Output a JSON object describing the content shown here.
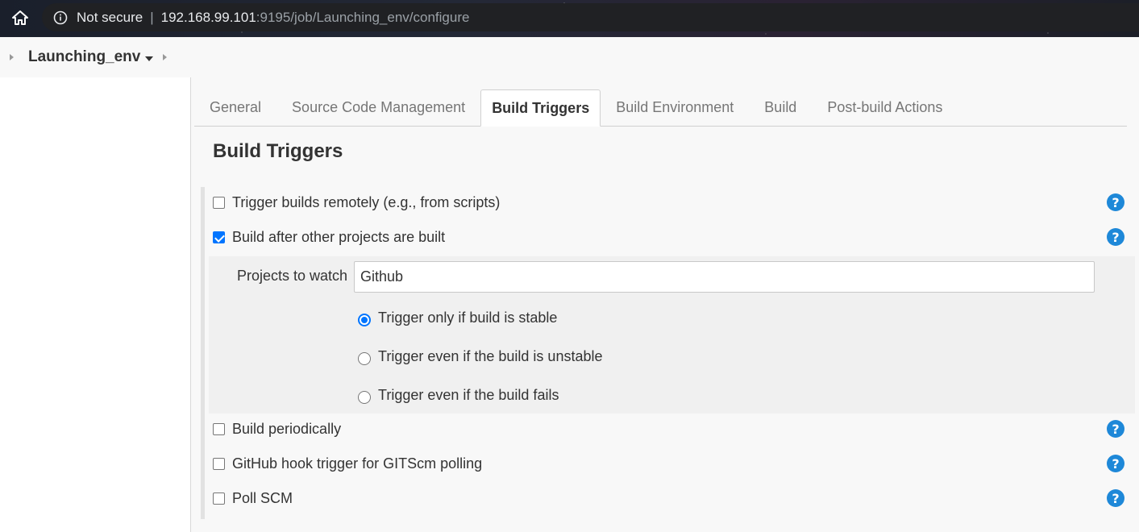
{
  "browser": {
    "home_icon": "home-icon",
    "security_icon": "info-icon",
    "security_label": "Not secure",
    "url_host": "192.168.99.101",
    "url_rest": ":9195/job/Launching_env/configure"
  },
  "breadcrumb": {
    "job_name": "Launching_env"
  },
  "tabs": [
    {
      "label": "General",
      "active": false
    },
    {
      "label": "Source Code Management",
      "active": false
    },
    {
      "label": "Build Triggers",
      "active": true
    },
    {
      "label": "Build Environment",
      "active": false
    },
    {
      "label": "Build",
      "active": false
    },
    {
      "label": "Post-build Actions",
      "active": false
    }
  ],
  "section": {
    "title": "Build Triggers"
  },
  "options": [
    {
      "label": "Trigger builds remotely (e.g., from scripts)",
      "checked": false
    },
    {
      "label": "Build after other projects are built",
      "checked": true
    },
    {
      "label": "Build periodically",
      "checked": false
    },
    {
      "label": "GitHub hook trigger for GITScm polling",
      "checked": false
    },
    {
      "label": "Poll SCM",
      "checked": false
    }
  ],
  "build_after": {
    "projects_label": "Projects to watch",
    "projects_value": "Github",
    "radios": [
      {
        "label": "Trigger only if build is stable",
        "selected": true
      },
      {
        "label": "Trigger even if the build is unstable",
        "selected": false
      },
      {
        "label": "Trigger even if the build fails",
        "selected": false
      }
    ]
  },
  "help_label": "?",
  "colors": {
    "accent": "#0075ff",
    "help": "#1e88d8"
  }
}
